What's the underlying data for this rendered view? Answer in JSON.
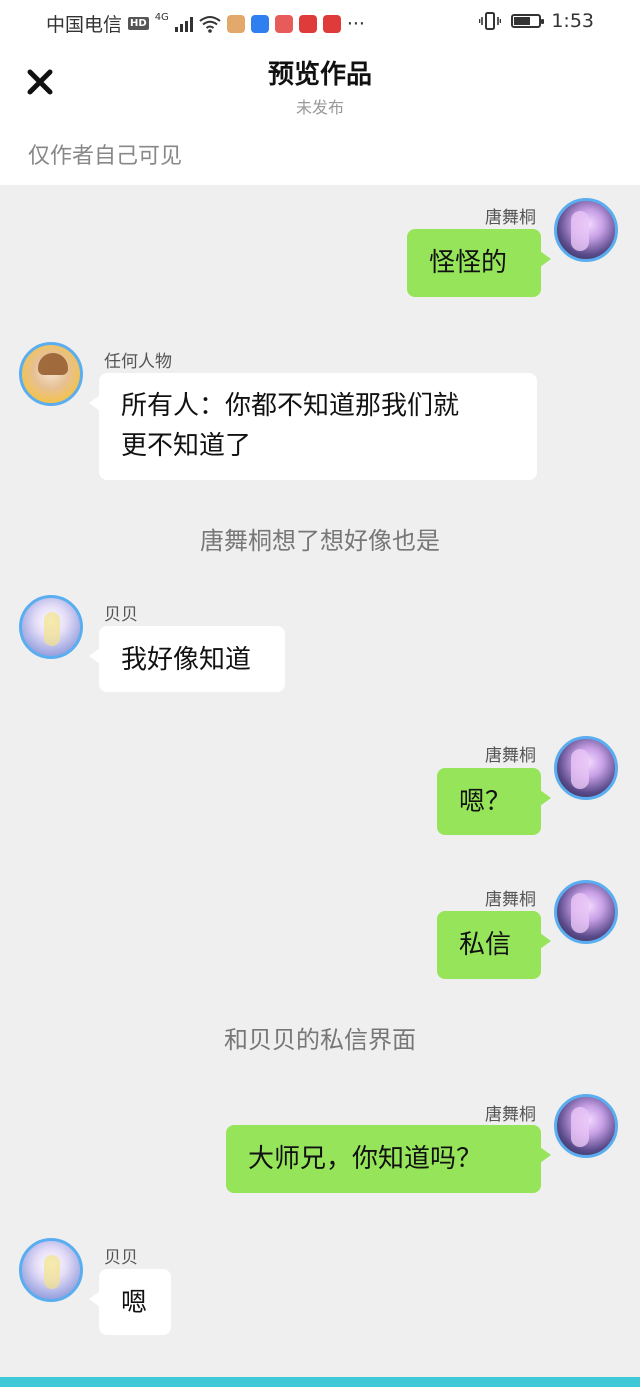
{
  "status_bar": {
    "carrier": "中国电信",
    "hd": "HD",
    "network": "4G",
    "time": "1:53",
    "more": "···"
  },
  "header": {
    "title": "预览作品",
    "subtitle": "未发布"
  },
  "visibility_note": "仅作者自己可见",
  "messages": [
    {
      "sender": "唐舞桐",
      "text": "怪怪的"
    },
    {
      "sender": "任何人物",
      "text_line1": "所有人：你都不知道那我们就",
      "text_line2": "更不知道了"
    },
    {
      "system": "唐舞桐想了想好像也是"
    },
    {
      "sender": "贝贝",
      "text": "我好像知道"
    },
    {
      "sender": "唐舞桐",
      "text": "嗯？"
    },
    {
      "sender": "唐舞桐",
      "text": "私信"
    },
    {
      "system": "和贝贝的私信界面"
    },
    {
      "sender": "唐舞桐",
      "text": "大师兄，你知道吗？"
    },
    {
      "sender": "贝贝",
      "text": "嗯"
    }
  ],
  "colors": {
    "sent_bubble": "#95e45a",
    "received_bubble": "#ffffff",
    "chat_background": "#efefef",
    "avatar_border": "#5aaef0",
    "bottom_accent": "#3fc8d6"
  }
}
